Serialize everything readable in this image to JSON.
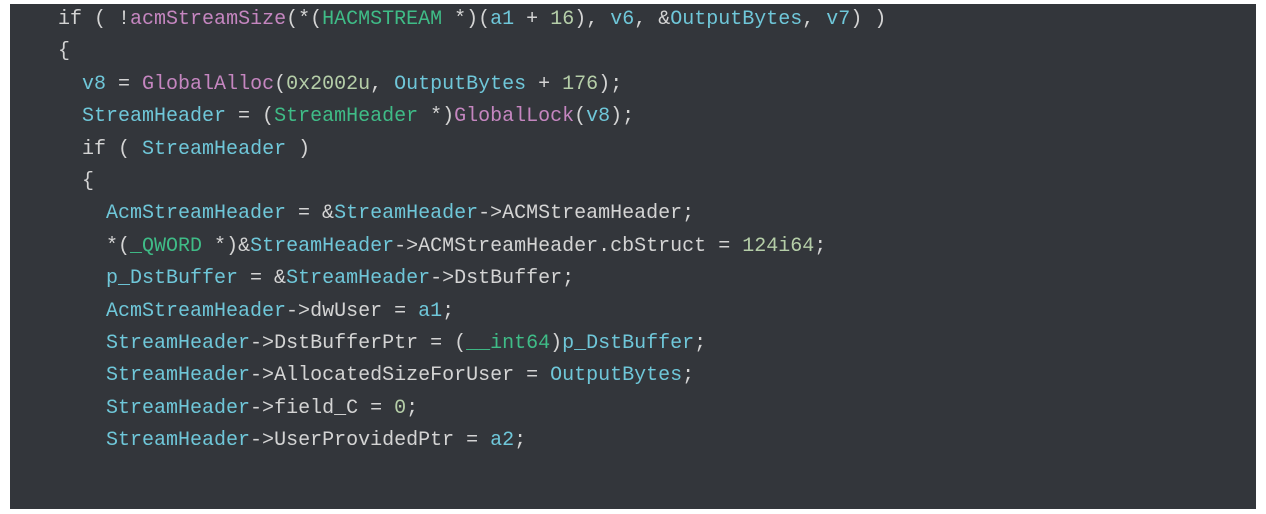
{
  "code": {
    "l1": {
      "indent": "    ",
      "kw_if": "if",
      "open": " ( !",
      "fn_acmStreamSize": "acmStreamSize",
      "p1": "(*(",
      "type_hacm": "HACMSTREAM",
      "star": " *",
      "p2": ")(",
      "var_a1": "a1",
      "plus": " + ",
      "num16": "16",
      "p3": "), ",
      "var_v6": "v6",
      "p4": ", &",
      "var_ob": "OutputBytes",
      "p5": ", ",
      "var_v7": "v7",
      "p6": ") )"
    },
    "l2": {
      "indent": "    ",
      "brace": "{"
    },
    "l3": {
      "indent": "      ",
      "var_v8": "v8",
      "eq": " = ",
      "fn_ga": "GlobalAlloc",
      "p1": "(",
      "num_0x2002u": "0x2002u",
      "p2": ", ",
      "var_ob": "OutputBytes",
      "plus": " + ",
      "num176": "176",
      "p3": ");"
    },
    "l4": {
      "indent": "      ",
      "var_sh": "StreamHeader",
      "eq": " = (",
      "type_sh": "StreamHeader",
      "star": " *)",
      "fn_gl": "GlobalLock",
      "p1": "(",
      "var_v8": "v8",
      "p2": ");"
    },
    "l5": {
      "indent": "      ",
      "kw_if": "if",
      "open": " ( ",
      "var_sh": "StreamHeader",
      "close": " )"
    },
    "l6": {
      "indent": "      ",
      "brace": "{"
    },
    "l7": {
      "indent": "        ",
      "var_ash": "AcmStreamHeader",
      "eq": " = &",
      "var_sh": "StreamHeader",
      "arrow": "->",
      "field": "ACMStreamHeader",
      "semi": ";"
    },
    "l8": {
      "indent": "        ",
      "p1": "*(",
      "type_qword": "_QWORD",
      "star": " *",
      "p2": ")&",
      "var_sh": "StreamHeader",
      "arrow": "->",
      "field1": "ACMStreamHeader",
      "dot": ".",
      "field2": "cbStruct",
      "eq": " = ",
      "num": "124i64",
      "semi": ";"
    },
    "l9": {
      "indent": "        ",
      "var_pdb": "p_DstBuffer",
      "eq": " = &",
      "var_sh": "StreamHeader",
      "arrow": "->",
      "field": "DstBuffer",
      "semi": ";"
    },
    "l10": {
      "indent": "        ",
      "var_ash": "AcmStreamHeader",
      "arrow": "->",
      "field": "dwUser",
      "eq": " = ",
      "var_a1": "a1",
      "semi": ";"
    },
    "l11": {
      "indent": "        ",
      "var_sh": "StreamHeader",
      "arrow": "->",
      "field": "DstBufferPtr",
      "eq": " = (",
      "type_int64": "__int64",
      "p2": ")",
      "var_pdb": "p_DstBuffer",
      "semi": ";"
    },
    "l12": {
      "indent": "        ",
      "var_sh": "StreamHeader",
      "arrow": "->",
      "field": "AllocatedSizeForUser",
      "eq": " = ",
      "var_ob": "OutputBytes",
      "semi": ";"
    },
    "l13": {
      "indent": "        ",
      "var_sh": "StreamHeader",
      "arrow": "->",
      "field": "field_C",
      "eq": " = ",
      "num0": "0",
      "semi": ";"
    },
    "l14": {
      "indent": "        ",
      "var_sh": "StreamHeader",
      "arrow": "->",
      "field": "UserProvidedPtr",
      "eq": " = ",
      "var_a2": "a2",
      "semi": ";"
    }
  }
}
